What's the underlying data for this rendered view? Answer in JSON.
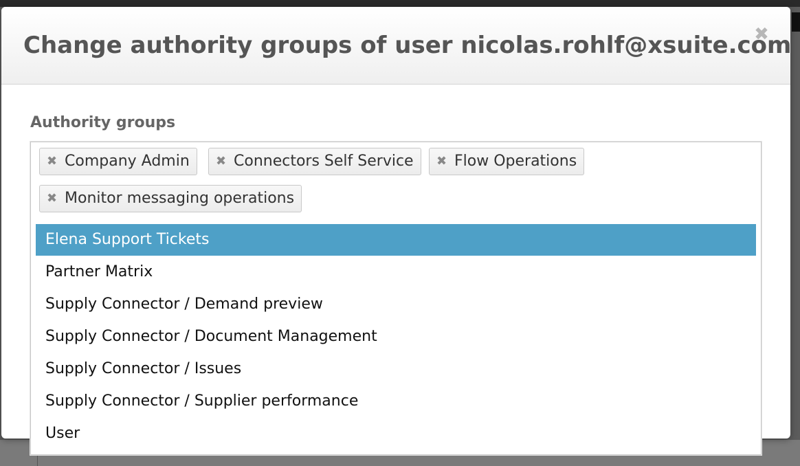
{
  "modal": {
    "title": "Change authority groups of user nicolas.rohlf@xsuite.com",
    "close_glyph": "✖",
    "field_label": "Authority groups"
  },
  "selected_groups": [
    {
      "label": "Company Admin",
      "remove_glyph": "✖"
    },
    {
      "label": "Connectors Self Service",
      "remove_glyph": "✖"
    },
    {
      "label": "Flow Operations",
      "remove_glyph": "✖"
    },
    {
      "label": "Monitor messaging operations",
      "remove_glyph": "✖"
    }
  ],
  "options": [
    {
      "label": "Elena Support Tickets",
      "highlighted": true
    },
    {
      "label": "Partner Matrix",
      "highlighted": false
    },
    {
      "label": "Supply Connector / Demand preview",
      "highlighted": false
    },
    {
      "label": "Supply Connector / Document Management",
      "highlighted": false
    },
    {
      "label": "Supply Connector / Issues",
      "highlighted": false
    },
    {
      "label": "Supply Connector / Supplier performance",
      "highlighted": false
    },
    {
      "label": "User",
      "highlighted": false
    }
  ],
  "colors": {
    "highlight": "#4ea0c7",
    "title_text": "#555555"
  }
}
